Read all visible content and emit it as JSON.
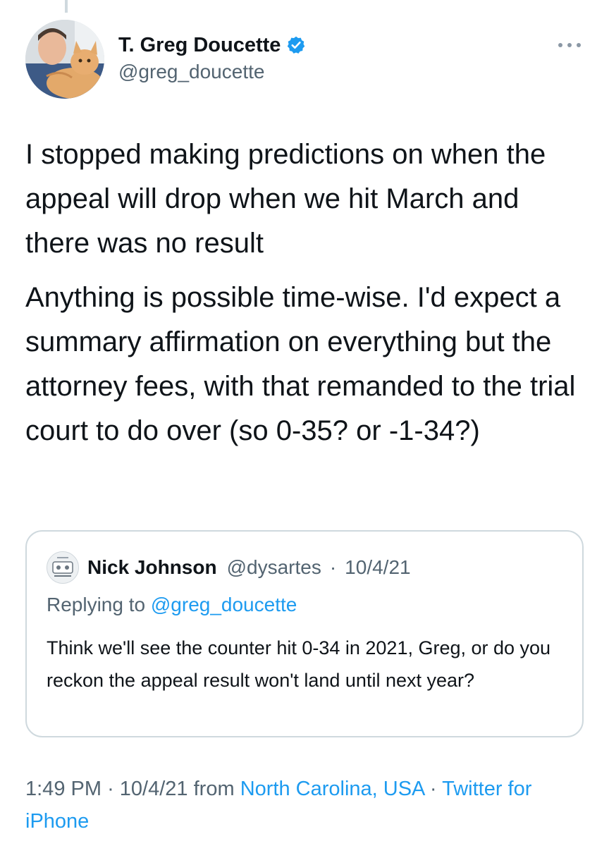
{
  "author": {
    "display_name": "T. Greg Doucette",
    "handle": "@greg_doucette",
    "verified": true,
    "avatar_icon": "profile-photo-man-with-orange-cat"
  },
  "tweet": {
    "paragraphs": [
      "I stopped making predictions on when the appeal will drop when we hit March and there was no result",
      "Anything is possible time-wise. I'd expect a summary affirmation on everything but the attorney fees, with that remanded to the trial court to do over (so 0-35? or -1-34?)"
    ]
  },
  "quoted_tweet": {
    "display_name": "Nick Johnson",
    "handle": "@dysartes",
    "separator": "·",
    "date": "10/4/21",
    "replying_prefix": "Replying to",
    "replying_mention": "@greg_doucette",
    "body": "Think we'll see the counter hit 0-34 in 2021, Greg, or do you reckon the appeal result won't land until next year?"
  },
  "meta": {
    "time": "1:49 PM",
    "sep1": "·",
    "date": "10/4/21",
    "from_label": "from",
    "location": "North Carolina, USA",
    "sep2": "·",
    "client": "Twitter for iPhone"
  },
  "colors": {
    "link": "#1d9bf0",
    "secondary_text": "#536471",
    "primary_text": "#0f1419",
    "border": "#cfd9de"
  }
}
